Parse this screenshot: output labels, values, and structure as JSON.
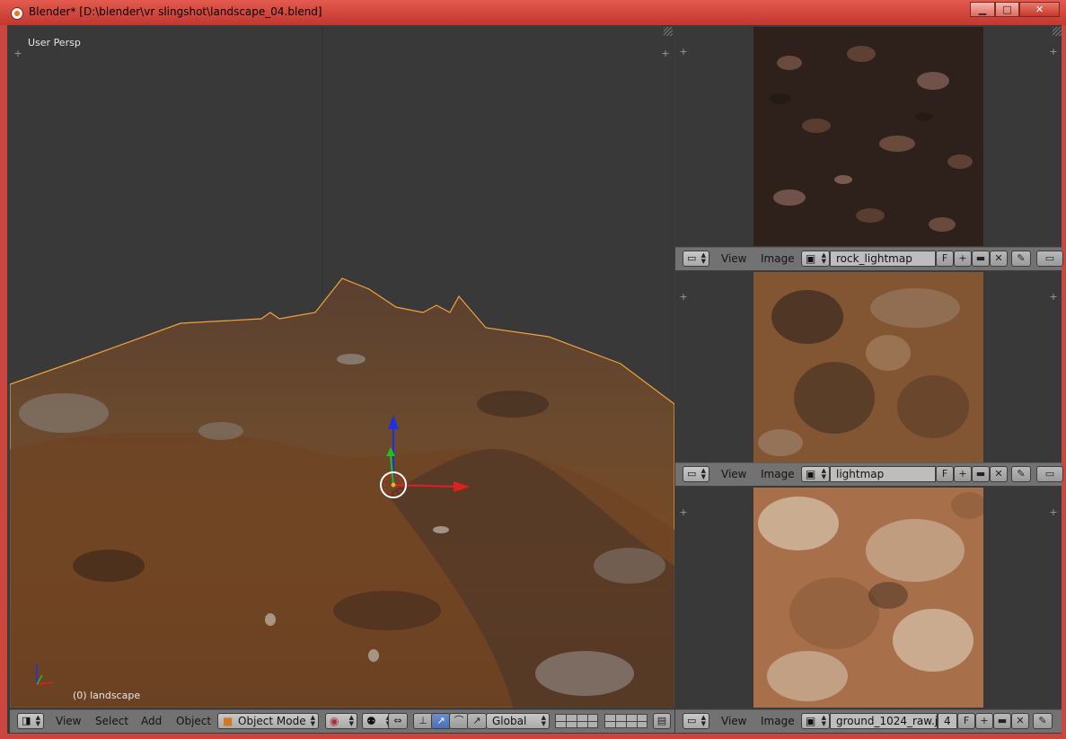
{
  "window": {
    "title": "Blender* [D:\\blender\\vr slingshot\\landscape_04.blend]",
    "minimize": "▁",
    "maximize": "□",
    "close": "✕"
  },
  "viewport": {
    "view_name": "User Persp",
    "object_label": "(0) landscape",
    "header": {
      "menus": [
        "View",
        "Select",
        "Add",
        "Object"
      ],
      "mode": "Object Mode",
      "orientation": "Global"
    }
  },
  "image_editors": [
    {
      "menus": [
        "View",
        "Image"
      ],
      "image_name": "rock_lightmap",
      "fake_user": "F",
      "texture_colors": [
        "#3a2a22",
        "#6b4a3e",
        "#241a16"
      ]
    },
    {
      "menus": [
        "View",
        "Image"
      ],
      "image_name": "lightmap",
      "fake_user": "F",
      "texture_colors": [
        "#6a4a30",
        "#8e5a32",
        "#3a2a1e"
      ]
    },
    {
      "menus": [
        "View",
        "Image"
      ],
      "image_name": "ground_1024_raw.j...",
      "users": "4",
      "fake_user": "F",
      "texture_colors": [
        "#b07a55",
        "#d6c0a8",
        "#8a5a3a"
      ]
    }
  ],
  "colors": {
    "titlebar": "#d44a3f",
    "viewport_bg": "#393939",
    "header_bg": "#727272",
    "selection_outline": "#f2a33a",
    "axis_x": "#e02020",
    "axis_y": "#20c020",
    "axis_z": "#2030e0"
  }
}
